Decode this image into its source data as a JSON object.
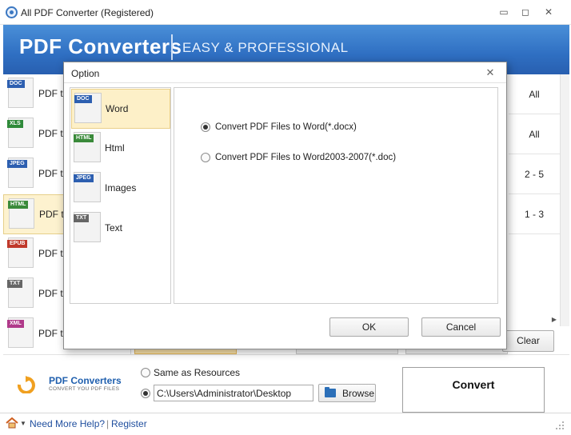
{
  "window": {
    "title": "All PDF Converter (Registered)",
    "controls": {
      "minimize": "▭",
      "maximize": "◻",
      "close": "✕"
    }
  },
  "banner": {
    "brand": "PDF Converters",
    "tagline": "EASY & PROFESSIONAL"
  },
  "conversion_list": {
    "items": [
      {
        "icon": "doc-file-icon",
        "tag": "DOC",
        "tag_color": "#2d5fb0",
        "label": "PDF to",
        "pages": "All",
        "selected": false
      },
      {
        "icon": "xls-file-icon",
        "tag": "XLS",
        "tag_color": "#2f8a3a",
        "label": "PDF to",
        "pages": "All",
        "selected": false
      },
      {
        "icon": "jpeg-file-icon",
        "tag": "JPEG",
        "tag_color": "#2d5fb0",
        "label": "PDF to",
        "pages": "2 - 5",
        "selected": false
      },
      {
        "icon": "html-file-icon",
        "tag": "HTML",
        "tag_color": "#3a8a3a",
        "label": "PDF to",
        "pages": "1 - 3",
        "selected": true
      },
      {
        "icon": "epub-file-icon",
        "tag": "EPUB",
        "tag_color": "#c0392b",
        "label": "PDF to",
        "pages": "",
        "selected": false
      },
      {
        "icon": "txt-file-icon",
        "tag": "TXT",
        "tag_color": "#666666",
        "label": "PDF to",
        "pages": "",
        "selected": false
      },
      {
        "icon": "xml-file-icon",
        "tag": "XML",
        "tag_color": "#b03a8a",
        "label": "PDF to",
        "pages": "",
        "selected": false
      }
    ]
  },
  "buttons": {
    "clear": "Clear",
    "browse": "Browse",
    "convert": "Convert"
  },
  "output": {
    "same_as_resources": "Same as Resources",
    "path_value": "C:\\Users\\Administrator\\Desktop",
    "selected": "path"
  },
  "logo": {
    "name": "PDF Converters",
    "subtitle": "CONVERT YOU PDF FILES"
  },
  "status_bar": {
    "help": "Need More Help?",
    "separator": "|",
    "register": "Register"
  },
  "dialog": {
    "title": "Option",
    "close": "✕",
    "options": [
      {
        "icon": "doc-file-icon",
        "tag": "DOC",
        "tag_color": "#2d5fb0",
        "label": "Word",
        "selected": true
      },
      {
        "icon": "html-file-icon",
        "tag": "HTML",
        "tag_color": "#3a8a3a",
        "label": "Html",
        "selected": false
      },
      {
        "icon": "jpeg-file-icon",
        "tag": "JPEG",
        "tag_color": "#2d5fb0",
        "label": "Images",
        "selected": false
      },
      {
        "icon": "txt-file-icon",
        "tag": "TXT",
        "tag_color": "#666666",
        "label": "Text",
        "selected": false
      }
    ],
    "word_formats": [
      {
        "label": "Convert PDF Files to Word(*.docx)",
        "checked": true
      },
      {
        "label": "Convert PDF Files to Word2003-2007(*.doc)",
        "checked": false
      }
    ],
    "ok": "OK",
    "cancel": "Cancel"
  },
  "colors": {
    "banner": "#2f6fc2",
    "selected_row": "#fdf2cf",
    "link": "#1f4e9e"
  }
}
